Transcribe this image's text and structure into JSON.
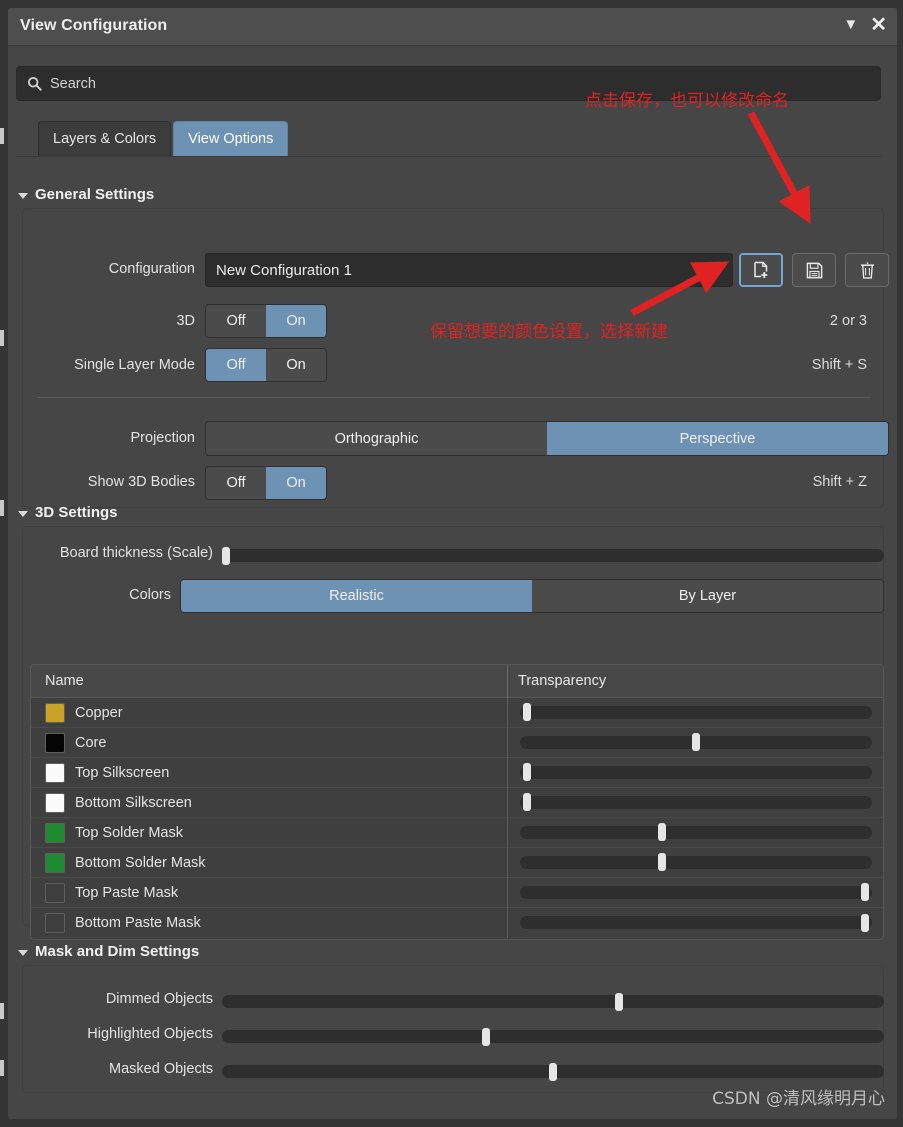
{
  "window": {
    "title": "View Configuration",
    "collapse_icon": "chevron-down-icon",
    "close_icon": "close-icon"
  },
  "search": {
    "placeholder": "Search",
    "value": "",
    "icon": "search-icon"
  },
  "tabs": [
    {
      "label": "Layers & Colors",
      "active": false
    },
    {
      "label": "View Options",
      "active": true
    }
  ],
  "general_settings": {
    "header": "General Settings",
    "configuration": {
      "label": "Configuration",
      "value": "New Configuration 1",
      "dropdown_icon": "chevron-down-icon"
    },
    "buttons": [
      {
        "name": "new-configuration-button",
        "icon": "new-page-plus-icon",
        "focused": true
      },
      {
        "name": "save-configuration-button",
        "icon": "floppy-disk-save-icon",
        "focused": false
      },
      {
        "name": "delete-configuration-button",
        "icon": "trash-icon",
        "focused": false
      }
    ],
    "three_d": {
      "label": "3D",
      "off": "Off",
      "on": "On",
      "selected": "On",
      "shortcut": "2 or 3"
    },
    "single_layer_mode": {
      "label": "Single Layer Mode",
      "off": "Off",
      "on": "On",
      "selected": "Off",
      "shortcut": "Shift + S"
    },
    "projection": {
      "label": "Projection",
      "options": [
        "Orthographic",
        "Perspective"
      ],
      "selected": "Perspective"
    },
    "show_3d_bodies": {
      "label": "Show 3D Bodies",
      "off": "Off",
      "on": "On",
      "selected": "On",
      "shortcut": "Shift + Z"
    }
  },
  "three_d_settings": {
    "header": "3D Settings",
    "board_thickness": {
      "label": "Board thickness (Scale)",
      "value": 1
    },
    "colors": {
      "label": "Colors",
      "options": [
        "Realistic",
        "By Layer"
      ],
      "selected": "Realistic"
    },
    "table": {
      "columns": [
        "Name",
        "Transparency"
      ],
      "rows": [
        {
          "name": "Copper",
          "color": "#c9a227",
          "transparency": 1
        },
        {
          "name": "Core",
          "color": "#050505",
          "transparency": 50
        },
        {
          "name": "Top Silkscreen",
          "color": "#fbfbfb",
          "transparency": 1
        },
        {
          "name": "Bottom Silkscreen",
          "color": "#fbfbfb",
          "transparency": 1
        },
        {
          "name": "Top Solder Mask",
          "color": "#1e8b33",
          "transparency": 40
        },
        {
          "name": "Bottom Solder Mask",
          "color": "#1e8b33",
          "transparency": 40
        },
        {
          "name": "Top Paste Mask",
          "color": "#3f3f3f",
          "transparency": 99
        },
        {
          "name": "Bottom Paste Mask",
          "color": "#3f3f3f",
          "transparency": 99
        }
      ]
    }
  },
  "mask_dim_settings": {
    "header": "Mask and Dim Settings",
    "sliders": [
      {
        "label": "Dimmed Objects",
        "value": 60
      },
      {
        "label": "Highlighted Objects",
        "value": 40
      },
      {
        "label": "Masked Objects",
        "value": 50
      }
    ]
  },
  "annotations": [
    {
      "text": "点击保存，也可以修改命名"
    },
    {
      "text": "保留想要的颜色设置，选择新建"
    }
  ],
  "watermark": "CSDN @清风缘明月心",
  "colors": {
    "accent": "#6d92b4",
    "panel": "#464646",
    "titlebar": "#4e4e4e",
    "field": "#2d2d2d",
    "annotation_red": "#e02222"
  }
}
